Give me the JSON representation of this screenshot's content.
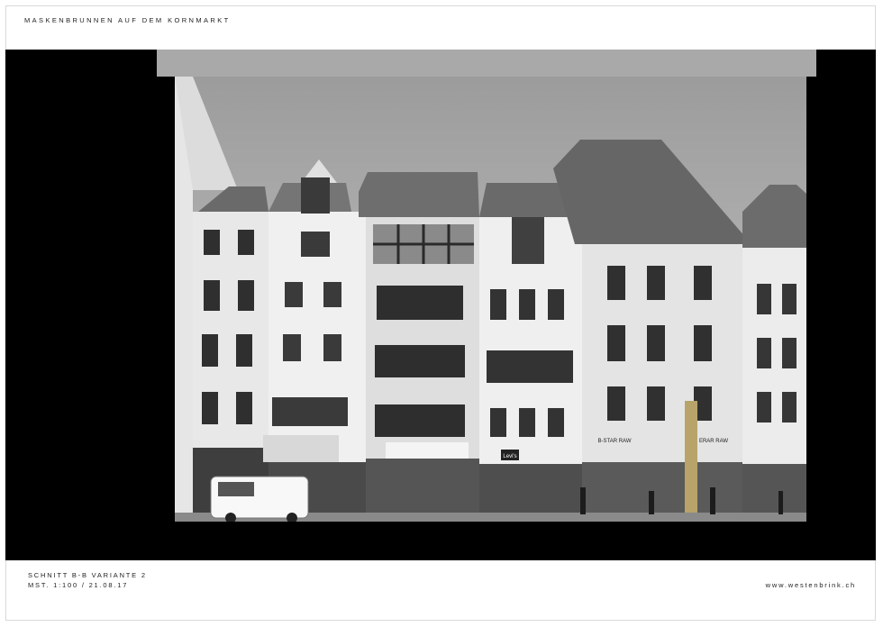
{
  "header": {
    "title": "MASKENBRUNNEN AUF DEM KORNMARKT"
  },
  "photo": {
    "signs": {
      "levis": "Levi's",
      "store_left": "B-STAR RAW",
      "store_right": "ERAR RAW"
    }
  },
  "footer": {
    "section_label": "SCHNITT B-B VARIANTE 2",
    "scale_date": "MST. 1:100 / 21.08.17",
    "website": "www.westenbrink.ch"
  },
  "colors": {
    "background": "#ffffff",
    "band": "#000000",
    "ceiling": "#a9a9a9"
  }
}
